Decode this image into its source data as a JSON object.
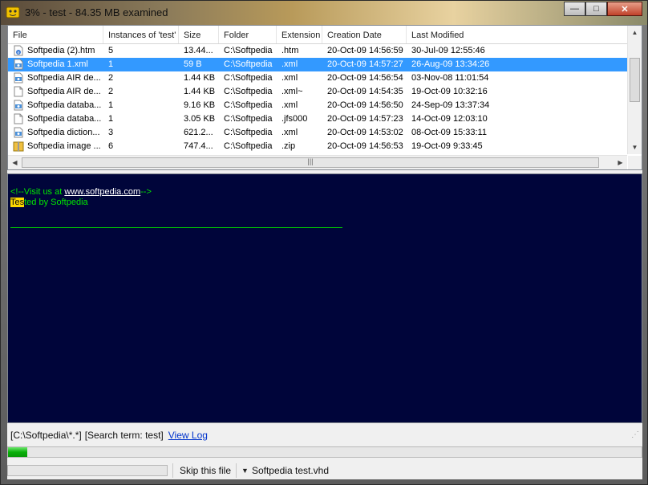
{
  "window": {
    "title": "3% - test - 84.35 MB examined",
    "buttons": {
      "minimize": "—",
      "maximize": "□",
      "close": "✕"
    }
  },
  "columns": [
    "File",
    "Instances of 'test'",
    "Size",
    "Folder",
    "Extension",
    "Creation Date",
    "Last Modified"
  ],
  "rows": [
    {
      "icon": "html-file-icon",
      "file": "Softpedia (2).htm",
      "instances": "5",
      "size": "13.44...",
      "folder": "C:\\Softpedia",
      "ext": ".htm",
      "created": "20-Oct-09 14:56:59",
      "modified": "30-Jul-09 12:55:46",
      "selected": false
    },
    {
      "icon": "xml-file-icon",
      "file": "Softpedia 1.xml",
      "instances": "1",
      "size": "59 B",
      "folder": "C:\\Softpedia",
      "ext": ".xml",
      "created": "20-Oct-09 14:57:27",
      "modified": "26-Aug-09 13:34:26",
      "selected": true
    },
    {
      "icon": "xml-file-icon",
      "file": "Softpedia AIR de...",
      "instances": "2",
      "size": "1.44 KB",
      "folder": "C:\\Softpedia",
      "ext": ".xml",
      "created": "20-Oct-09 14:56:54",
      "modified": "03-Nov-08 11:01:54",
      "selected": false
    },
    {
      "icon": "blank-file-icon",
      "file": "Softpedia AIR de...",
      "instances": "2",
      "size": "1.44 KB",
      "folder": "C:\\Softpedia",
      "ext": ".xml~",
      "created": "20-Oct-09 14:54:35",
      "modified": "19-Oct-09 10:32:16",
      "selected": false
    },
    {
      "icon": "xml-file-icon",
      "file": "Softpedia databa...",
      "instances": "1",
      "size": "9.16 KB",
      "folder": "C:\\Softpedia",
      "ext": ".xml",
      "created": "20-Oct-09 14:56:50",
      "modified": "24-Sep-09 13:37:34",
      "selected": false
    },
    {
      "icon": "blank-file-icon",
      "file": "Softpedia databa...",
      "instances": "1",
      "size": "3.05 KB",
      "folder": "C:\\Softpedia",
      "ext": ".jfs000",
      "created": "20-Oct-09 14:57:23",
      "modified": "14-Oct-09 12:03:10",
      "selected": false
    },
    {
      "icon": "xml-file-icon",
      "file": "Softpedia diction...",
      "instances": "3",
      "size": "621.2...",
      "folder": "C:\\Softpedia",
      "ext": ".xml",
      "created": "20-Oct-09 14:53:02",
      "modified": "08-Oct-09 15:33:11",
      "selected": false
    },
    {
      "icon": "zip-file-icon",
      "file": "Softpedia image ...",
      "instances": "6",
      "size": "747.4...",
      "folder": "C:\\Softpedia",
      "ext": ".zip",
      "created": "20-Oct-09 14:56:53",
      "modified": "19-Oct-09 9:33:45",
      "selected": false
    }
  ],
  "preview": {
    "line1_prefix": "<!--Visit us at ",
    "line1_link": "www.softpedia.com",
    "line1_suffix": "-->",
    "line2_match": "Tes",
    "line2_rest": "ted by Softpedia"
  },
  "status": {
    "path": "[C:\\Softpedia\\*.*]",
    "search_term": "[Search term: test]",
    "view_log": "View Log"
  },
  "progress": {
    "overall": 0.03,
    "file": 0.0
  },
  "bottom": {
    "skip_label": "Skip this file",
    "current_file": "Softpedia test.vhd"
  },
  "colors": {
    "selection": "#3399ff",
    "preview_bg": "#00053a",
    "preview_text": "#00e800",
    "highlight": "#ffd800"
  }
}
